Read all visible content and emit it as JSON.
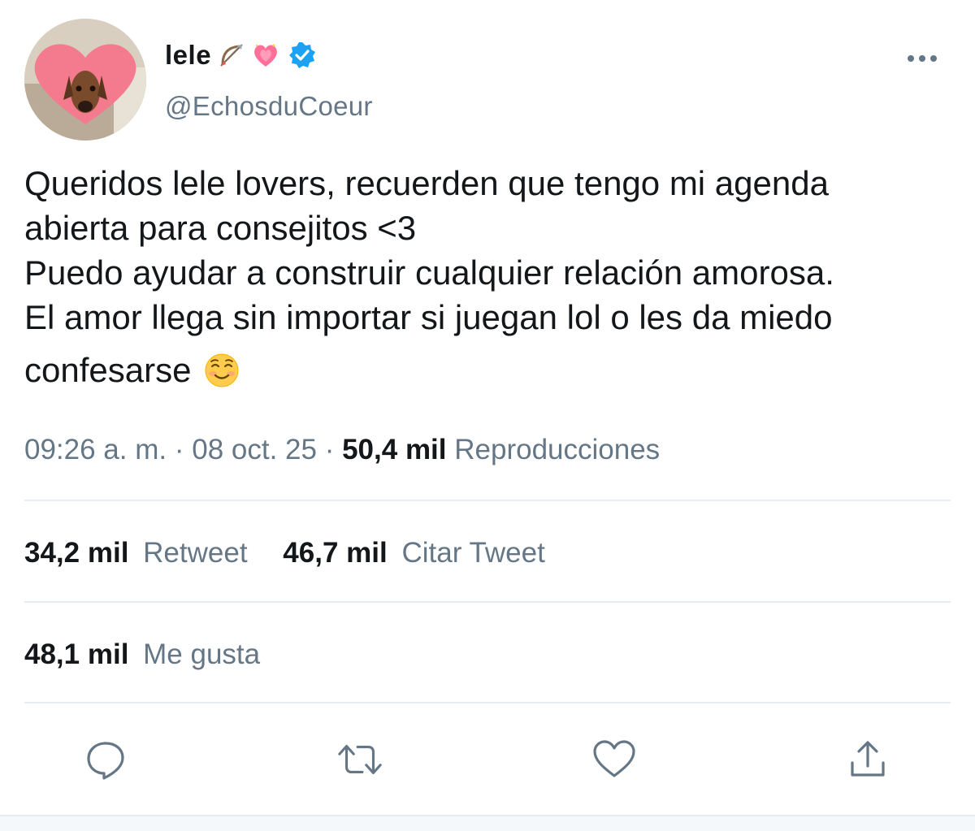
{
  "author": {
    "display_name": "lele",
    "display_emojis": [
      "bow-and-arrow-icon",
      "sparkling-heart-icon"
    ],
    "verified": true,
    "handle": "@EchosduCoeur"
  },
  "tweet": {
    "text_lines": "Queridos lele lovers, recuerden que tengo mi agenda\nabierta para consejitos <3\nPuedo ayudar a construir cualquier relación amorosa.\nEl amor llega sin importar si juegan lol o les da miedo",
    "last_line": "confesarse",
    "last_emoji": "smiling-face-icon"
  },
  "meta": {
    "time": "09:26 a. m.",
    "separator": "·",
    "date": "08 oct. 25",
    "views_count": "50,4 mil",
    "views_label": "Reproducciones"
  },
  "stats": {
    "retweets_count": "34,2 mil",
    "retweets_label": "Retweet",
    "quotes_count": "46,7 mil",
    "quotes_label": "Citar Tweet",
    "likes_count": "48,1 mil",
    "likes_label": "Me gusta"
  },
  "actions": [
    "reply-icon",
    "retweet-icon",
    "like-icon",
    "share-icon"
  ],
  "colors": {
    "text_primary": "#14171a",
    "text_secondary": "#657786",
    "divider": "#e6ecf0",
    "verified_blue": "#1da1f2",
    "heart_pink": "#ff6f9a"
  }
}
